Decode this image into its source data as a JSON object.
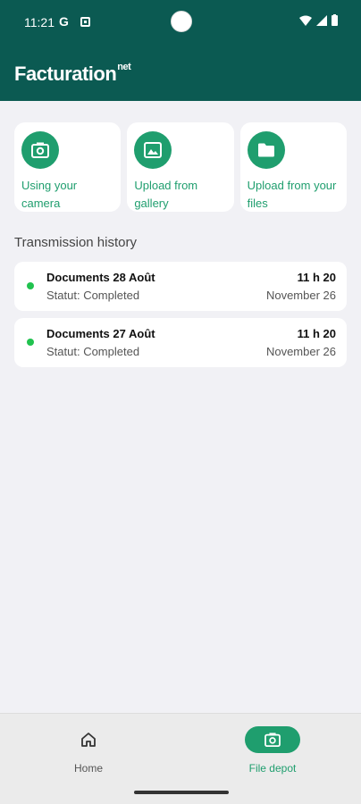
{
  "status_bar": {
    "time": "11:21",
    "g_label": "G"
  },
  "app": {
    "brand_main": "Facturation",
    "brand_sup": "net"
  },
  "actions": [
    {
      "label": "Using your camera",
      "icon": "camera-icon"
    },
    {
      "label": "Upload from gallery",
      "icon": "image-icon"
    },
    {
      "label": "Upload from your files",
      "icon": "folder-icon"
    }
  ],
  "history": {
    "title": "Transmission history",
    "items": [
      {
        "title": "Documents 28 Août",
        "status": "Statut: Completed",
        "time": "11 h 20",
        "date": "November 26"
      },
      {
        "title": "Documents 27 Août",
        "status": "Statut: Completed",
        "time": "11 h 20",
        "date": "November 26"
      }
    ]
  },
  "nav": {
    "home_label": "Home",
    "file_label": "File depot"
  },
  "colors": {
    "header": "#0b5a52",
    "accent": "#1f9e6e",
    "status_dot": "#21c24f"
  }
}
